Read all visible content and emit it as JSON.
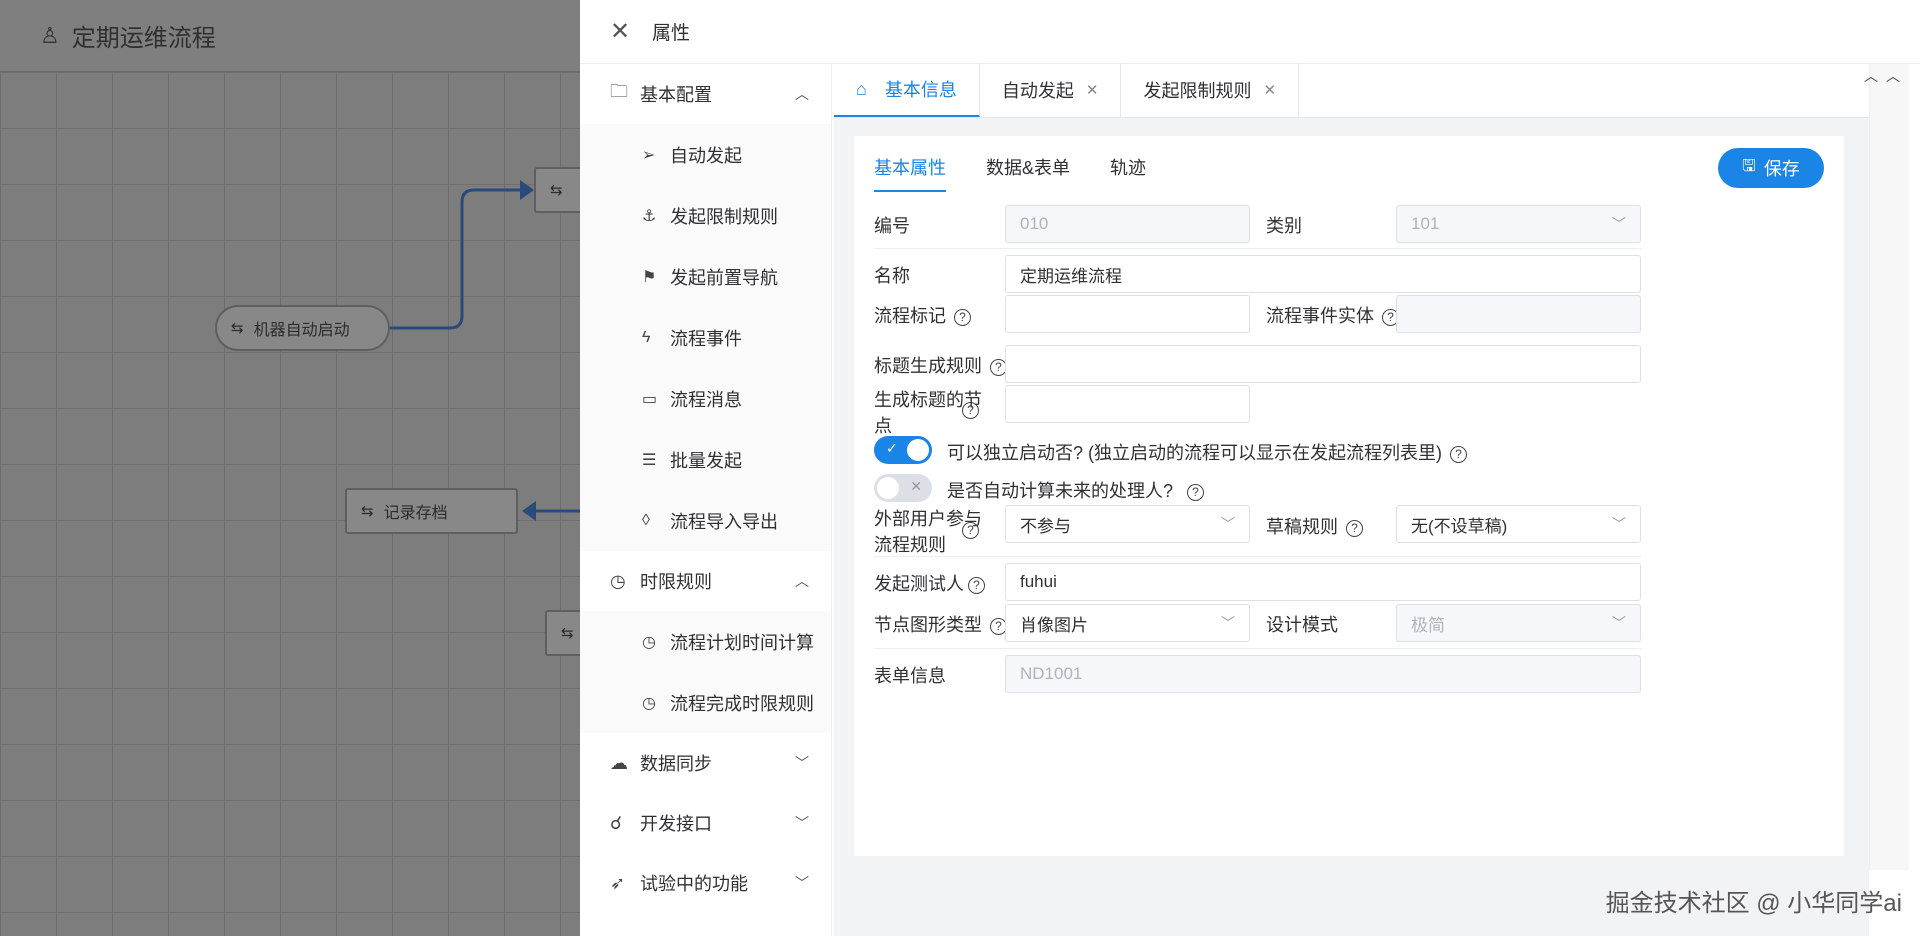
{
  "canvas": {
    "title": "定期运维流程",
    "nodes": [
      {
        "label": "机器自动启动",
        "icon": "flow-node-icon"
      },
      {
        "label": "记录存档",
        "icon": "flow-node-icon"
      }
    ]
  },
  "panel": {
    "title": "属性",
    "sidebar": {
      "groups": [
        {
          "label": "基本配置",
          "icon": "folder-icon",
          "expanded": true,
          "items": [
            {
              "label": "自动发起",
              "icon": "send-icon"
            },
            {
              "label": "发起限制规则",
              "icon": "anchor-icon"
            },
            {
              "label": "发起前置导航",
              "icon": "signpost-icon"
            },
            {
              "label": "流程事件",
              "icon": "lightning-icon"
            },
            {
              "label": "流程消息",
              "icon": "message-icon"
            },
            {
              "label": "批量发起",
              "icon": "list-icon"
            },
            {
              "label": "流程导入导出",
              "icon": "drop-icon"
            }
          ]
        },
        {
          "label": "时限规则",
          "icon": "clock-icon",
          "expanded": true,
          "items": [
            {
              "label": "流程计划时间计算",
              "icon": "clock-icon"
            },
            {
              "label": "流程完成时限规则",
              "icon": "clock-icon"
            }
          ]
        },
        {
          "label": "数据同步",
          "icon": "cloud-upload-icon",
          "expanded": false,
          "items": []
        },
        {
          "label": "开发接口",
          "icon": "api-icon",
          "expanded": false,
          "items": []
        },
        {
          "label": "试验中的功能",
          "icon": "rocket-icon",
          "expanded": false,
          "items": []
        }
      ]
    },
    "tabs": [
      {
        "label": "基本信息",
        "active": true,
        "closable": false
      },
      {
        "label": "自动发起",
        "active": false,
        "closable": true
      },
      {
        "label": "发起限制规则",
        "active": false,
        "closable": true
      }
    ],
    "subtabs": [
      "基本属性",
      "数据&表单",
      "轨迹"
    ],
    "save_label": "保存",
    "form": {
      "no_label": "编号",
      "no_value": "010",
      "category_label": "类别",
      "category_value": "101",
      "name_label": "名称",
      "name_value": "定期运维流程",
      "mark_label": "流程标记",
      "mark_value": "",
      "event_entity_label": "流程事件实体",
      "event_entity_value": "",
      "title_rule_label": "标题生成规则",
      "title_rule_value": "",
      "title_node_label_1": "生成标题的节",
      "title_node_label_2": "点",
      "title_node_value": "",
      "independent_label": "可以独立启动否? (独立启动的流程可以显示在发起流程列表里)",
      "independent_on": true,
      "auto_calc_label": "是否自动计算未来的处理人?",
      "auto_calc_on": false,
      "external_label_1": "外部用户参与",
      "external_label_2": "流程规则",
      "external_value": "不参与",
      "draft_label": "草稿规则",
      "draft_value": "无(不设草稿)",
      "tester_label": "发起测试人",
      "tester_value": "fuhui",
      "node_shape_label": "节点图形类型",
      "node_shape_value": "肖像图片",
      "design_mode_label": "设计模式",
      "design_mode_value": "极简",
      "form_info_label": "表单信息",
      "form_info_value": "ND1001"
    }
  },
  "watermark": "掘金技术社区 @ 小华同学ai"
}
